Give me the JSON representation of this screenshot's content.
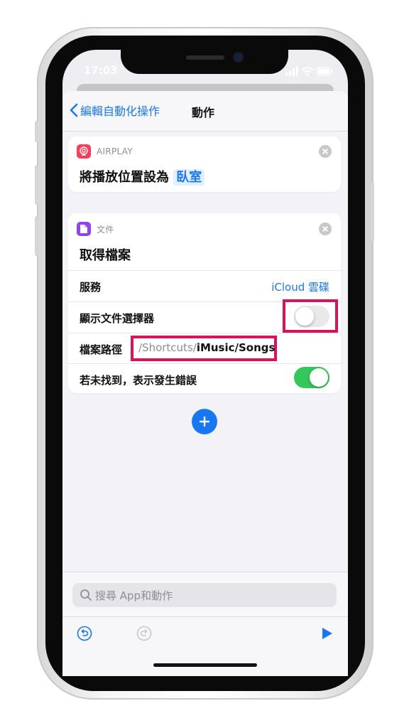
{
  "status_bar": {
    "time": "17:03"
  },
  "nav": {
    "back_label": "編輯自動化操作",
    "title": "動作"
  },
  "airplay_action": {
    "app_label": "AIRPLAY",
    "title_prefix": "將播放位置設為",
    "device_token": "臥室"
  },
  "file_action": {
    "app_label": "文件",
    "title": "取得檔案",
    "rows": {
      "service": {
        "label": "服務",
        "value": "iCloud 雲碟"
      },
      "show_picker": {
        "label": "顯示文件選擇器",
        "on": false
      },
      "file_path": {
        "label": "檔案路徑",
        "path_prefix": "/Shortcuts/",
        "path_rest": "iMusic/Songs"
      },
      "error_if_not_found": {
        "label": "若未找到，表示發生錯誤",
        "on": true
      }
    }
  },
  "search": {
    "placeholder": "搜尋 App和動作"
  },
  "colors": {
    "accent": "#1878f3",
    "highlight": "#d5145a",
    "toggle_on": "#34c759",
    "airplay": "#ff3b5c",
    "files": "#8e44f0"
  }
}
